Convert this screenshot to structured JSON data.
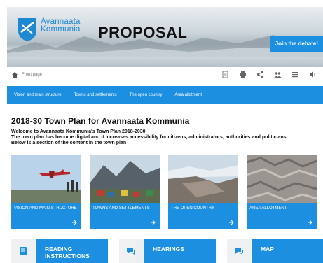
{
  "hero": {
    "logo_line1": "Avannaata",
    "logo_line2": "Kommunia",
    "heading": "PROPOSAL",
    "debate_button": "Join the debate!"
  },
  "breadcrumb": {
    "home": "Front page"
  },
  "toolbar": {
    "icons": [
      "pdf-icon",
      "print-icon",
      "share-icon",
      "users-icon",
      "list-icon",
      "speaker-icon"
    ]
  },
  "nav": {
    "items": [
      "Vision and main structure",
      "Towns and settlements",
      "The open country",
      "Area allotment"
    ]
  },
  "main": {
    "title": "2018-30 Town Plan for Avannaata Kommunia",
    "intro_1": "Welcome to Avannaata Kommunia's Town Plan 2018-2030.",
    "intro_2": "The town plan has become digital and it increases accessibility for citizens, administrators, authorities and politicians.",
    "intro_3": "Below is a section of the content in the town plan"
  },
  "cards": [
    {
      "label": "VISION AND MAIN STRUCTURE"
    },
    {
      "label": "TOWNS AND SETTLEMENTS"
    },
    {
      "label": "THE OPEN COUNTRY"
    },
    {
      "label": "AREA ALLOTMENT"
    }
  ],
  "bottom": {
    "reading": "READING INSTRUCTIONS",
    "hearings": "HEARINGS",
    "map": "MAP"
  },
  "colors": {
    "accent": "#1d8fe0",
    "logo": "#1e88d3"
  }
}
